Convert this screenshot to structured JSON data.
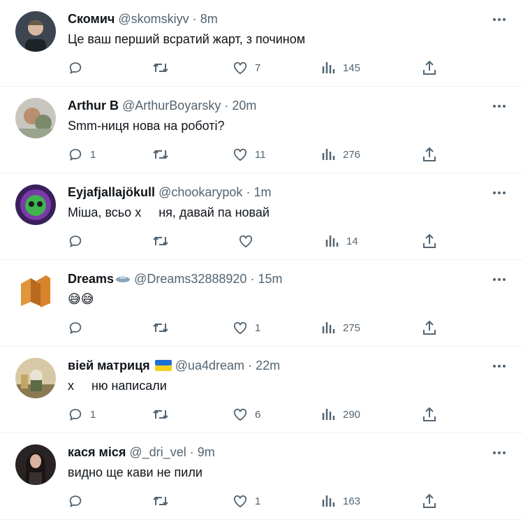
{
  "colors": {
    "text": "#0f1419",
    "muted": "#536471",
    "divider": "#eff3f4"
  },
  "icons": {
    "more": "more-dots-icon",
    "reply": "reply-icon",
    "retweet": "retweet-icon",
    "like": "heart-icon",
    "views": "views-icon",
    "share": "share-icon"
  },
  "tweets": [
    {
      "name": "Скомич",
      "handle": "@skomskiyv",
      "dot": "·",
      "time": "8m",
      "text": "Це ваш перший всратий жарт, з почином",
      "replies": "",
      "retweets": "",
      "likes": "7",
      "views": "145"
    },
    {
      "name": "Arthur B",
      "handle": "@ArthurBoyarsky",
      "dot": "·",
      "time": "20m",
      "text": "Smm-ниця нова на роботі?",
      "replies": "1",
      "retweets": "",
      "likes": "11",
      "views": "276"
    },
    {
      "name": "Eyjafjallajökull",
      "handle": "@chookarypok",
      "dot": "·",
      "time": "1m",
      "text": "Міша, всьо х     ня, давай па новай",
      "replies": "",
      "retweets": "",
      "likes": "",
      "views": "14"
    },
    {
      "name": "Dreams",
      "handle": "@Dreams32888920",
      "dot": "·",
      "time": "15m",
      "text": "😅😅",
      "replies": "",
      "retweets": "",
      "likes": "1",
      "views": "275"
    },
    {
      "name": "віей матриця",
      "handle": "@ua4dream",
      "dot": "·",
      "time": "22m",
      "text": "х     ню написали",
      "replies": "1",
      "retweets": "",
      "likes": "6",
      "views": "290"
    },
    {
      "name": "кася міся",
      "handle": "@_dri_vel",
      "dot": "·",
      "time": "9m",
      "text": "видно ще кави не пили",
      "replies": "",
      "retweets": "",
      "likes": "1",
      "views": "163"
    }
  ]
}
